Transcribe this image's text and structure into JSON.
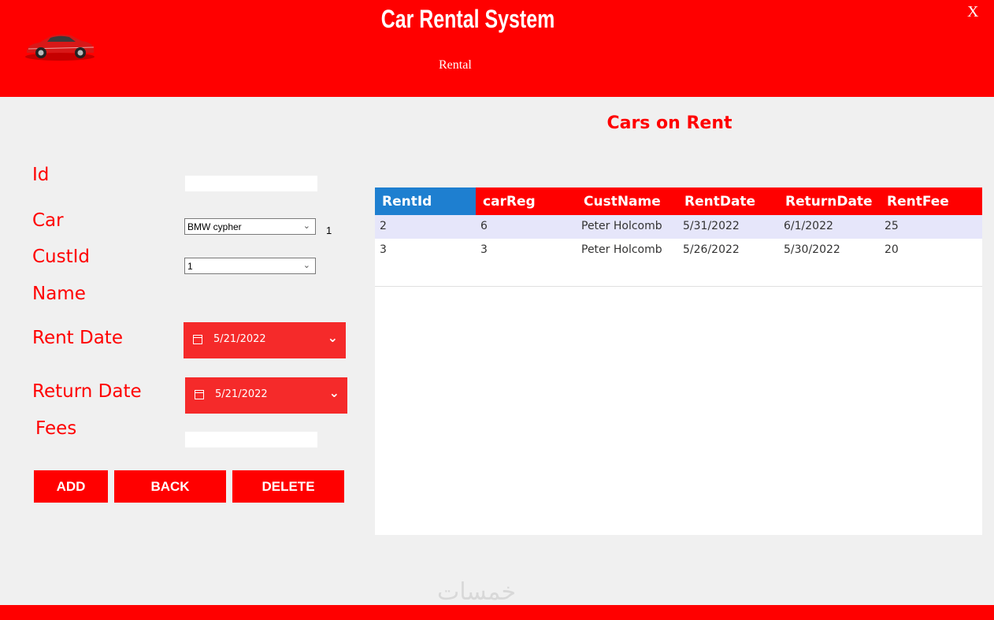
{
  "header": {
    "title": "Car Rental System",
    "subtitle": "Rental",
    "close_label": "X"
  },
  "section_title": "Cars on Rent",
  "form": {
    "labels": {
      "id": "Id",
      "car": "Car",
      "custid": "CustId",
      "name": "Name",
      "rent_date": "Rent Date",
      "return_date": "Return Date",
      "fees": "Fees"
    },
    "id_value": "",
    "car_selected": "BMW cypher",
    "car_side_value": "1",
    "custid_selected": "1",
    "rent_date": "5/21/2022",
    "return_date": "5/21/2022",
    "fees_value": ""
  },
  "buttons": {
    "add": "ADD",
    "back": "BACK",
    "delete": "DELETE"
  },
  "grid": {
    "columns": [
      "RentId",
      "carReg",
      "CustName",
      "RentDate",
      "ReturnDate",
      "RentFee"
    ],
    "rows": [
      [
        "2",
        "6",
        "Peter Holcomb",
        "5/31/2022",
        "6/1/2022",
        "25"
      ],
      [
        "3",
        "3",
        "Peter Holcomb",
        "5/26/2022",
        "5/30/2022",
        "20"
      ]
    ]
  },
  "watermark": "خمسات",
  "colors": {
    "accent": "#ff0000",
    "selected_header": "#1e7fd0",
    "row_highlight": "#e6e6fa"
  }
}
